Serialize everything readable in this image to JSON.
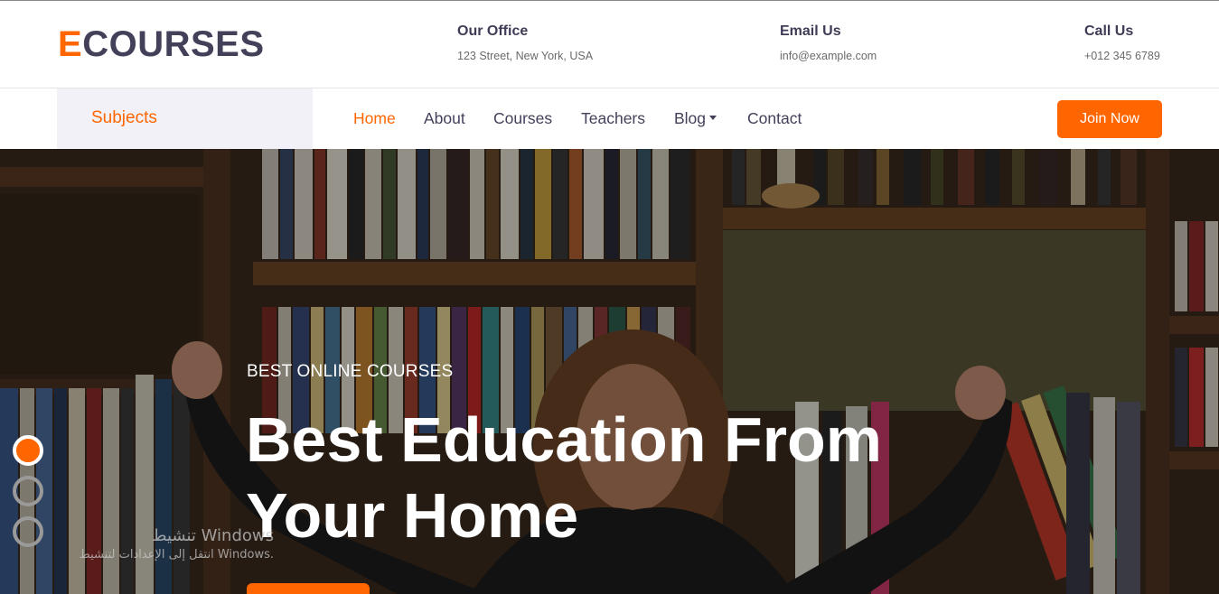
{
  "brand": {
    "first_letter": "E",
    "rest": "COURSES"
  },
  "contacts": [
    {
      "title": "Our Office",
      "value": "123 Street, New York, USA"
    },
    {
      "title": "Email Us",
      "value": "info@example.com"
    },
    {
      "title": "Call Us",
      "value": "+012 345 6789"
    }
  ],
  "nav": {
    "subjects_label": "Subjects",
    "items": [
      "Home",
      "About",
      "Courses",
      "Teachers",
      "Blog",
      "Contact"
    ],
    "active": "Home",
    "join_label": "Join Now"
  },
  "hero": {
    "subtitle": "BEST ONLINE COURSES",
    "headline_line1": "Best Education From",
    "headline_line2": "Your Home",
    "carousel_dots": 3,
    "active_dot": 0
  },
  "watermark": {
    "line1": "تنشيط Windows",
    "line2": "انتقل إلى الإعدادات لتنشيط Windows."
  },
  "colors": {
    "accent": "#ff6600",
    "text_dark": "#43415a",
    "subjects_bg": "#f2f1f8"
  }
}
